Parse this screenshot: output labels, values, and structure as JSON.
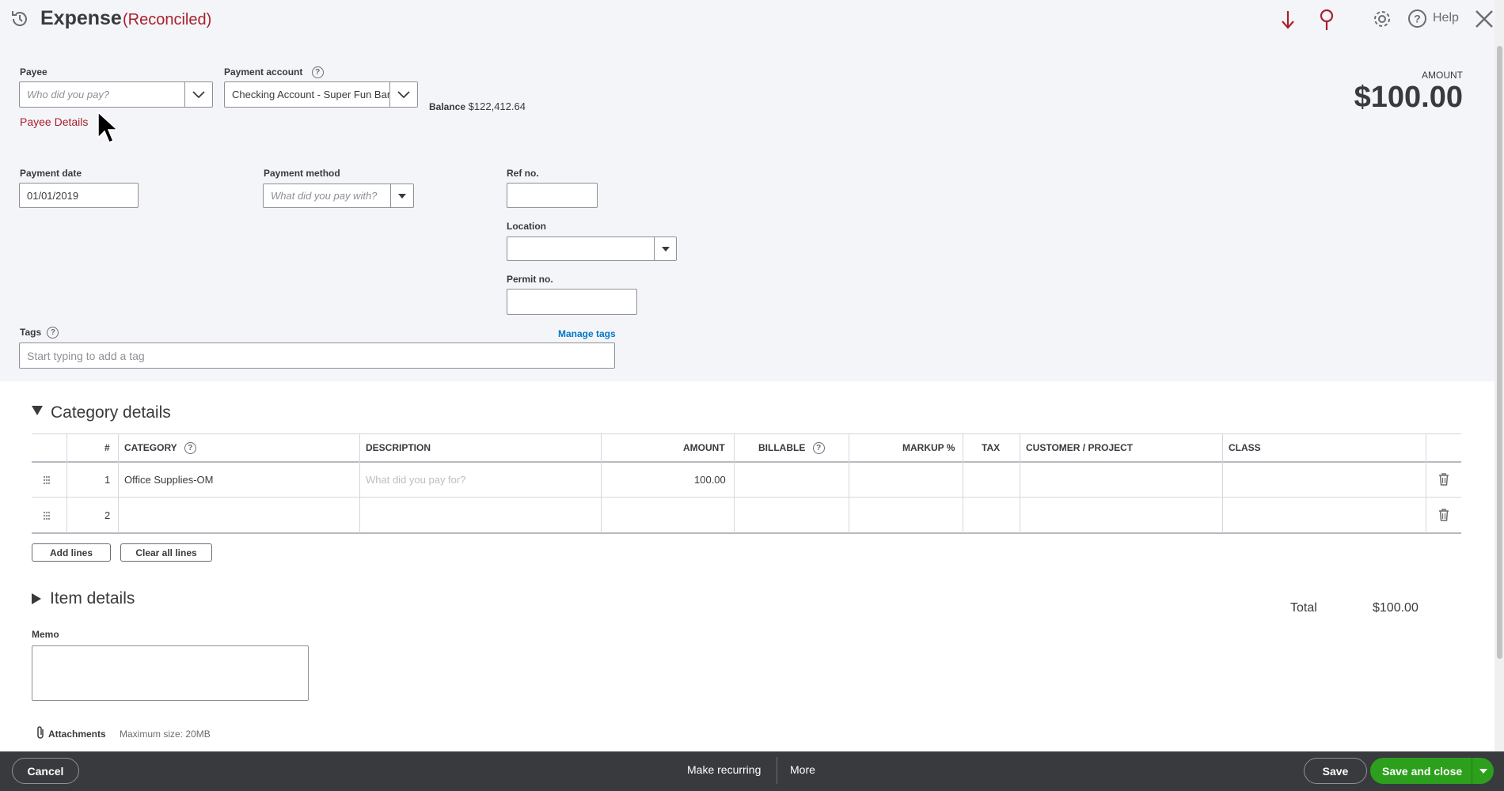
{
  "header": {
    "title": "Expense",
    "status": "(Reconciled)",
    "help_label": "Help"
  },
  "payee": {
    "label": "Payee",
    "placeholder": "Who did you pay?",
    "details_link": "Payee Details"
  },
  "payment_account": {
    "label": "Payment account",
    "value": "Checking Account - Super Fun Bank",
    "balance_label": "Balance",
    "balance_value": "$122,412.64"
  },
  "amount": {
    "label": "AMOUNT",
    "value": "$100.00"
  },
  "payment_date": {
    "label": "Payment date",
    "value": "01/01/2019"
  },
  "payment_method": {
    "label": "Payment method",
    "placeholder": "What did you pay with?"
  },
  "ref_no": {
    "label": "Ref no.",
    "value": ""
  },
  "location": {
    "label": "Location",
    "value": ""
  },
  "permit_no": {
    "label": "Permit no.",
    "value": ""
  },
  "tags": {
    "label": "Tags",
    "manage_link": "Manage tags",
    "placeholder": "Start typing to add a tag"
  },
  "category_details": {
    "title": "Category details",
    "columns": [
      "#",
      "CATEGORY",
      "DESCRIPTION",
      "AMOUNT",
      "BILLABLE",
      "MARKUP %",
      "TAX",
      "CUSTOMER / PROJECT",
      "CLASS"
    ],
    "rows": [
      {
        "num": "1",
        "category": "Office Supplies-OM",
        "description_placeholder": "What did you pay for?",
        "amount": "100.00"
      },
      {
        "num": "2",
        "category": "",
        "description_placeholder": "",
        "amount": ""
      }
    ],
    "add_lines": "Add lines",
    "clear_all_lines": "Clear all lines"
  },
  "item_details": {
    "title": "Item details"
  },
  "total": {
    "label": "Total",
    "value": "$100.00"
  },
  "memo": {
    "label": "Memo",
    "value": ""
  },
  "attachments": {
    "label": "Attachments",
    "max_size": "Maximum size: 20MB"
  },
  "footer": {
    "cancel": "Cancel",
    "make_recurring": "Make recurring",
    "more": "More",
    "save": "Save",
    "save_and_close": "Save and close"
  },
  "colors": {
    "accent_red": "#a8202d",
    "link_blue": "#0077c5",
    "green": "#2ca01c",
    "footer_bg": "#393a3d"
  }
}
